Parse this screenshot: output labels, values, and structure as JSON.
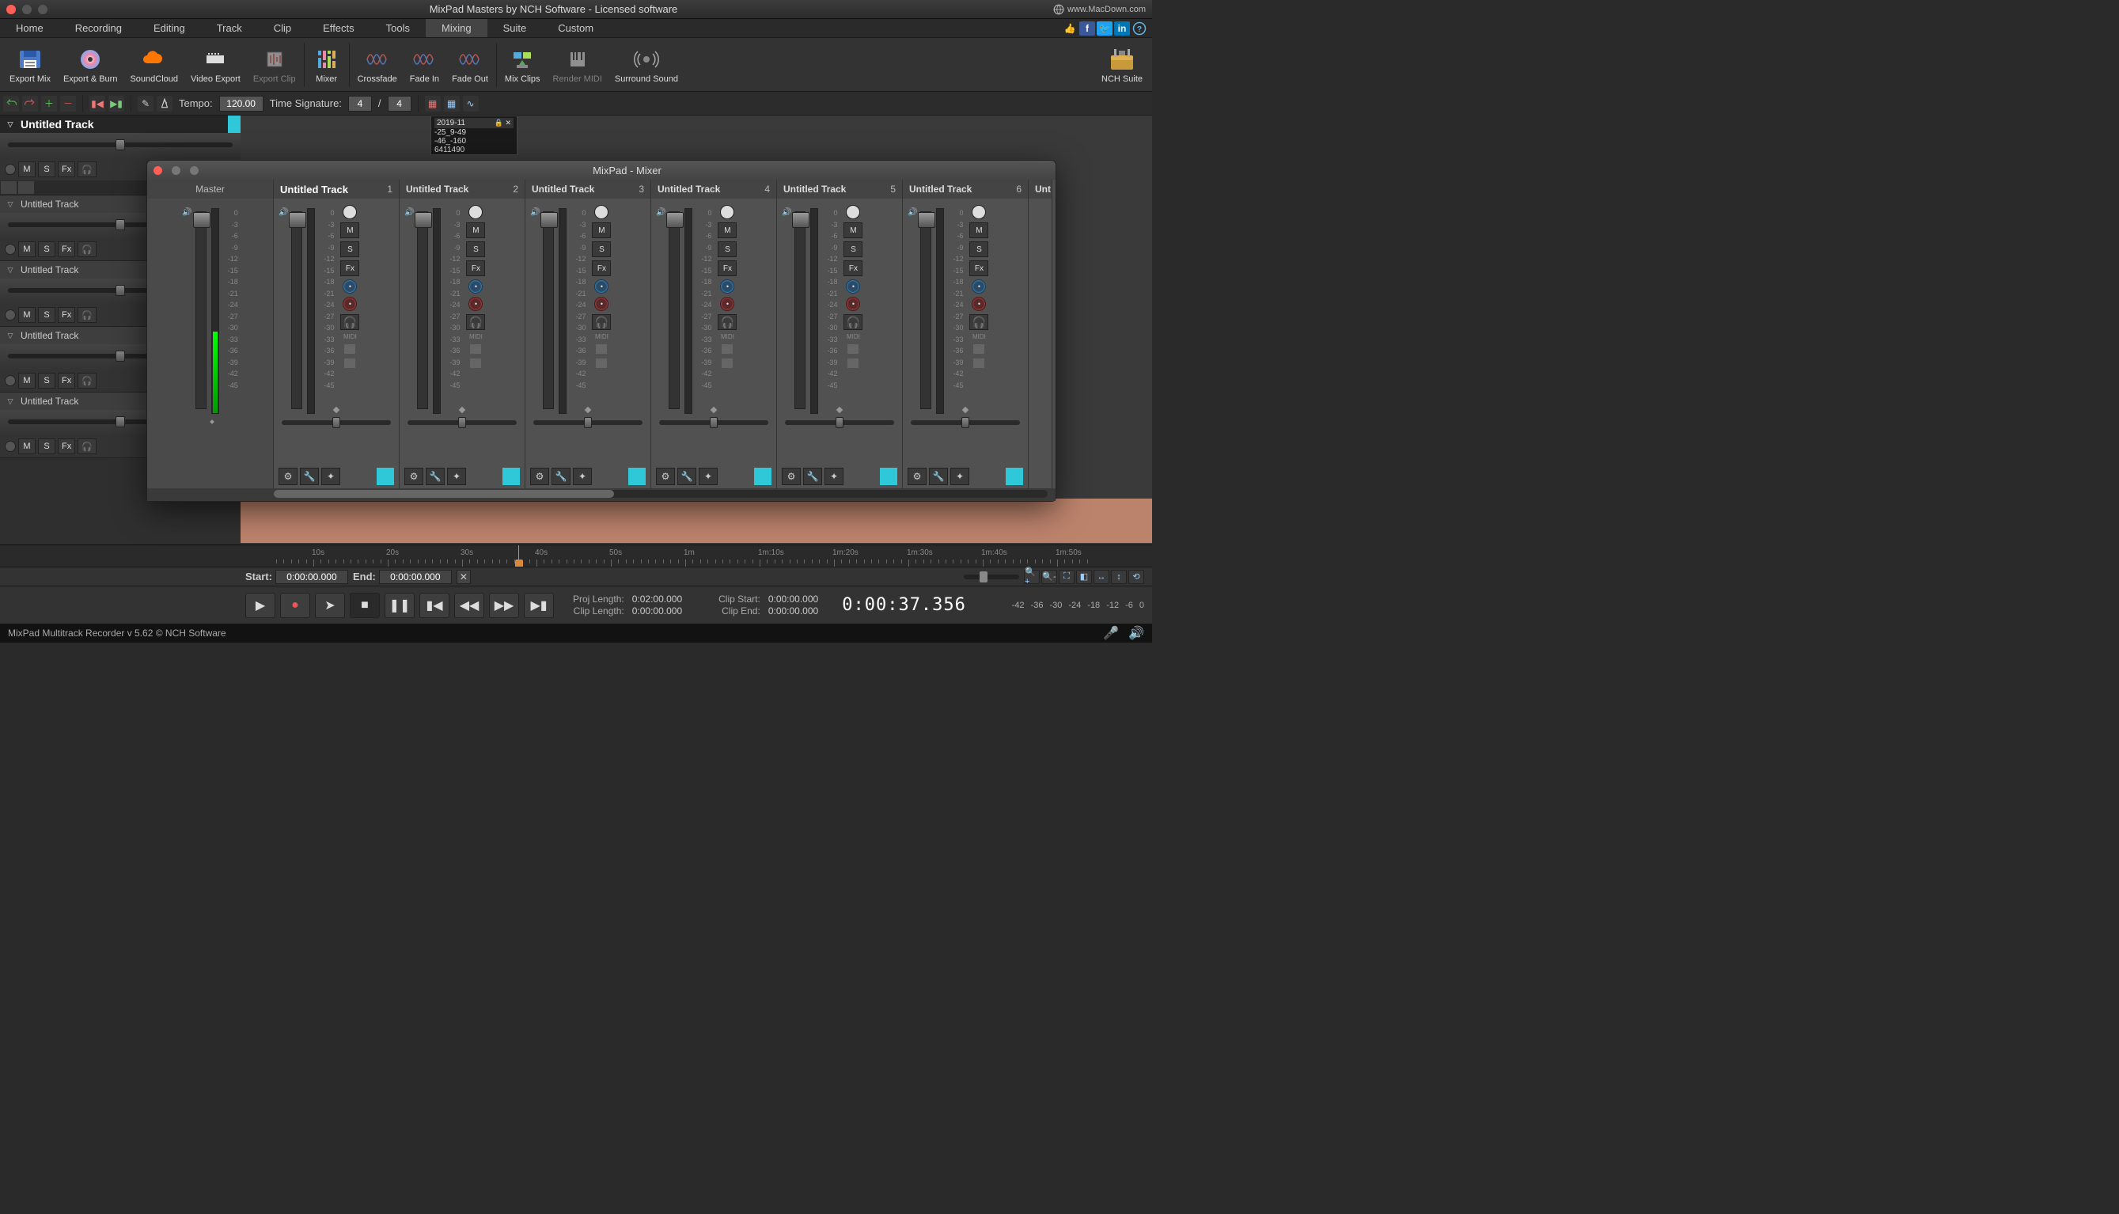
{
  "titlebar": {
    "title": "MixPad Masters by NCH Software - Licensed software",
    "site": "www.MacDown.com"
  },
  "menu": {
    "tabs": [
      "Home",
      "Recording",
      "Editing",
      "Track",
      "Clip",
      "Effects",
      "Tools",
      "Mixing",
      "Suite",
      "Custom"
    ],
    "active": "Mixing"
  },
  "ribbon": {
    "items": [
      {
        "label": "Export Mix",
        "icon": "save",
        "disabled": false
      },
      {
        "label": "Export & Burn",
        "icon": "disc",
        "disabled": false
      },
      {
        "label": "SoundCloud",
        "icon": "cloud",
        "disabled": false
      },
      {
        "label": "Video Export",
        "icon": "film",
        "disabled": false
      },
      {
        "label": "Export Clip",
        "icon": "clip",
        "disabled": true
      },
      {
        "label": "Mixer",
        "icon": "mixer",
        "disabled": false
      },
      {
        "label": "Crossfade",
        "icon": "wave",
        "disabled": false
      },
      {
        "label": "Fade In",
        "icon": "wave",
        "disabled": false
      },
      {
        "label": "Fade Out",
        "icon": "wave",
        "disabled": false
      },
      {
        "label": "Mix Clips",
        "icon": "mixclips",
        "disabled": false
      },
      {
        "label": "Render MIDI",
        "icon": "midi",
        "disabled": true
      },
      {
        "label": "Surround Sound",
        "icon": "surround",
        "disabled": false
      }
    ],
    "suite": "NCH Suite"
  },
  "sec": {
    "tempo_label": "Tempo:",
    "tempo": "120.00",
    "timesig_label": "Time Signature:",
    "ts_num": "4",
    "ts_den": "4",
    "slash": "/"
  },
  "tracks": [
    {
      "name": "Untitled Track",
      "first": true
    },
    {
      "name": "Untitled Track"
    },
    {
      "name": "Untitled Track"
    },
    {
      "name": "Untitled Track"
    },
    {
      "name": "Untitled Track"
    }
  ],
  "track_btns": {
    "m": "M",
    "s": "S",
    "fx": "Fx",
    "hp": "🎧"
  },
  "clip": {
    "title": "2019-11",
    "lines": [
      "-25_9-49",
      "-46_-160",
      "6411490"
    ]
  },
  "mixer": {
    "title": "MixPad - Mixer",
    "master_label": "Master",
    "channels": [
      {
        "name": "Untitled Track",
        "num": "1",
        "active": true
      },
      {
        "name": "Untitled Track",
        "num": "2"
      },
      {
        "name": "Untitled Track",
        "num": "3"
      },
      {
        "name": "Untitled Track",
        "num": "4"
      },
      {
        "name": "Untitled Track",
        "num": "5"
      },
      {
        "name": "Untitled Track",
        "num": "6"
      }
    ],
    "db_master": [
      "0",
      "-3",
      "-6",
      "-9",
      "-12",
      "-15",
      "-18",
      "-21",
      "-24",
      "-27",
      "-30",
      "-33",
      "-36",
      "-39",
      "-42",
      "-45"
    ],
    "db_channel": [
      "0",
      "-3",
      "-6",
      "-9",
      "-12",
      "-15",
      "-18",
      "-21",
      "-24",
      "-27",
      "-30",
      "-33",
      "-36",
      "-39",
      "-42",
      "-45"
    ],
    "btns": {
      "m": "M",
      "s": "S",
      "fx": "Fx",
      "midi": "MIDI"
    }
  },
  "ruler": {
    "marks": [
      "10s",
      "20s",
      "30s",
      "40s",
      "50s",
      "1m",
      "1m:10s",
      "1m:20s",
      "1m:30s",
      "1m:40s",
      "1m:50s"
    ]
  },
  "between": {
    "start_label": "Start:",
    "start": "0:00:00.000",
    "end_label": "End:",
    "end": "0:00:00.000"
  },
  "transport": {
    "proj_len_label": "Proj Length:",
    "proj_len": "0:02:00.000",
    "clip_len_label": "Clip Length:",
    "clip_len": "0:00:00.000",
    "clip_start_label": "Clip Start:",
    "clip_start": "0:00:00.000",
    "clip_end_label": "Clip End:",
    "clip_end": "0:00:00.000",
    "big_time": "0:00:37.356",
    "db_marks": [
      "-42",
      "-36",
      "-30",
      "-24",
      "-18",
      "-12",
      "-6",
      "0"
    ]
  },
  "status": {
    "text": "MixPad Multitrack Recorder v 5.62 © NCH Software"
  }
}
